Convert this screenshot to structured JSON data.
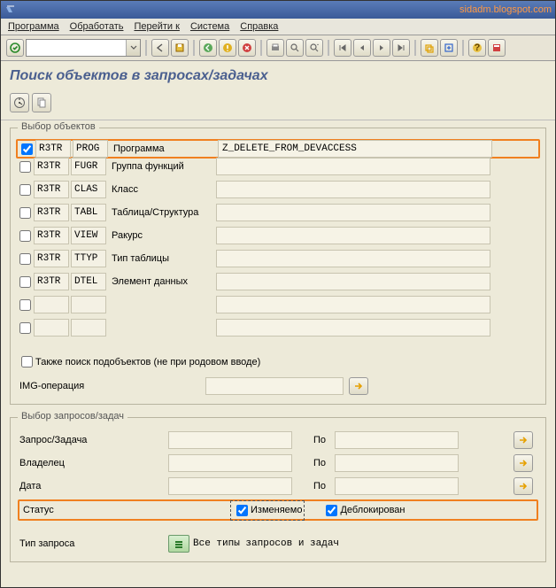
{
  "header": {
    "blog_url": "sidadm.blogspot.com"
  },
  "menu": {
    "program": "Программа",
    "process": "Обработать",
    "goto": "Перейти к",
    "system": "Система",
    "help": "Справка"
  },
  "page": {
    "title": "Поиск объектов в запросах/задачах"
  },
  "objects_group": {
    "label": "Выбор объектов",
    "rows": [
      {
        "checked": true,
        "c1": "R3TR",
        "c2": "PROG",
        "label": "Программа",
        "value": "Z_DELETE_FROM_DEVACCESS"
      },
      {
        "checked": false,
        "c1": "R3TR",
        "c2": "FUGR",
        "label": "Группа функций",
        "value": ""
      },
      {
        "checked": false,
        "c1": "R3TR",
        "c2": "CLAS",
        "label": "Класс",
        "value": ""
      },
      {
        "checked": false,
        "c1": "R3TR",
        "c2": "TABL",
        "label": "Таблица/Структура",
        "value": ""
      },
      {
        "checked": false,
        "c1": "R3TR",
        "c2": "VIEW",
        "label": "Ракурс",
        "value": ""
      },
      {
        "checked": false,
        "c1": "R3TR",
        "c2": "TTYP",
        "label": "Тип таблицы",
        "value": ""
      },
      {
        "checked": false,
        "c1": "R3TR",
        "c2": "DTEL",
        "label": "Элемент данных",
        "value": ""
      },
      {
        "checked": false,
        "c1": "",
        "c2": "",
        "label": "",
        "value": ""
      },
      {
        "checked": false,
        "c1": "",
        "c2": "",
        "label": "",
        "value": ""
      }
    ],
    "subobjects_checked": false,
    "subobjects_label": "Также поиск подобъектов (не при родовом вводе)",
    "img_operation_label": "IMG-операция",
    "img_operation_value": ""
  },
  "requests_group": {
    "label": "Выбор запросов/задач",
    "request_label": "Запрос/Задача",
    "owner_label": "Владелец",
    "date_label": "Дата",
    "po": "По",
    "status_label": "Статус",
    "status_mod_checked": true,
    "status_mod_label": "Изменяемо",
    "status_unblk_checked": true,
    "status_unblk_label": "Деблокирован",
    "type_label": "Тип запроса",
    "type_value": "Все типы запросов и задач"
  }
}
